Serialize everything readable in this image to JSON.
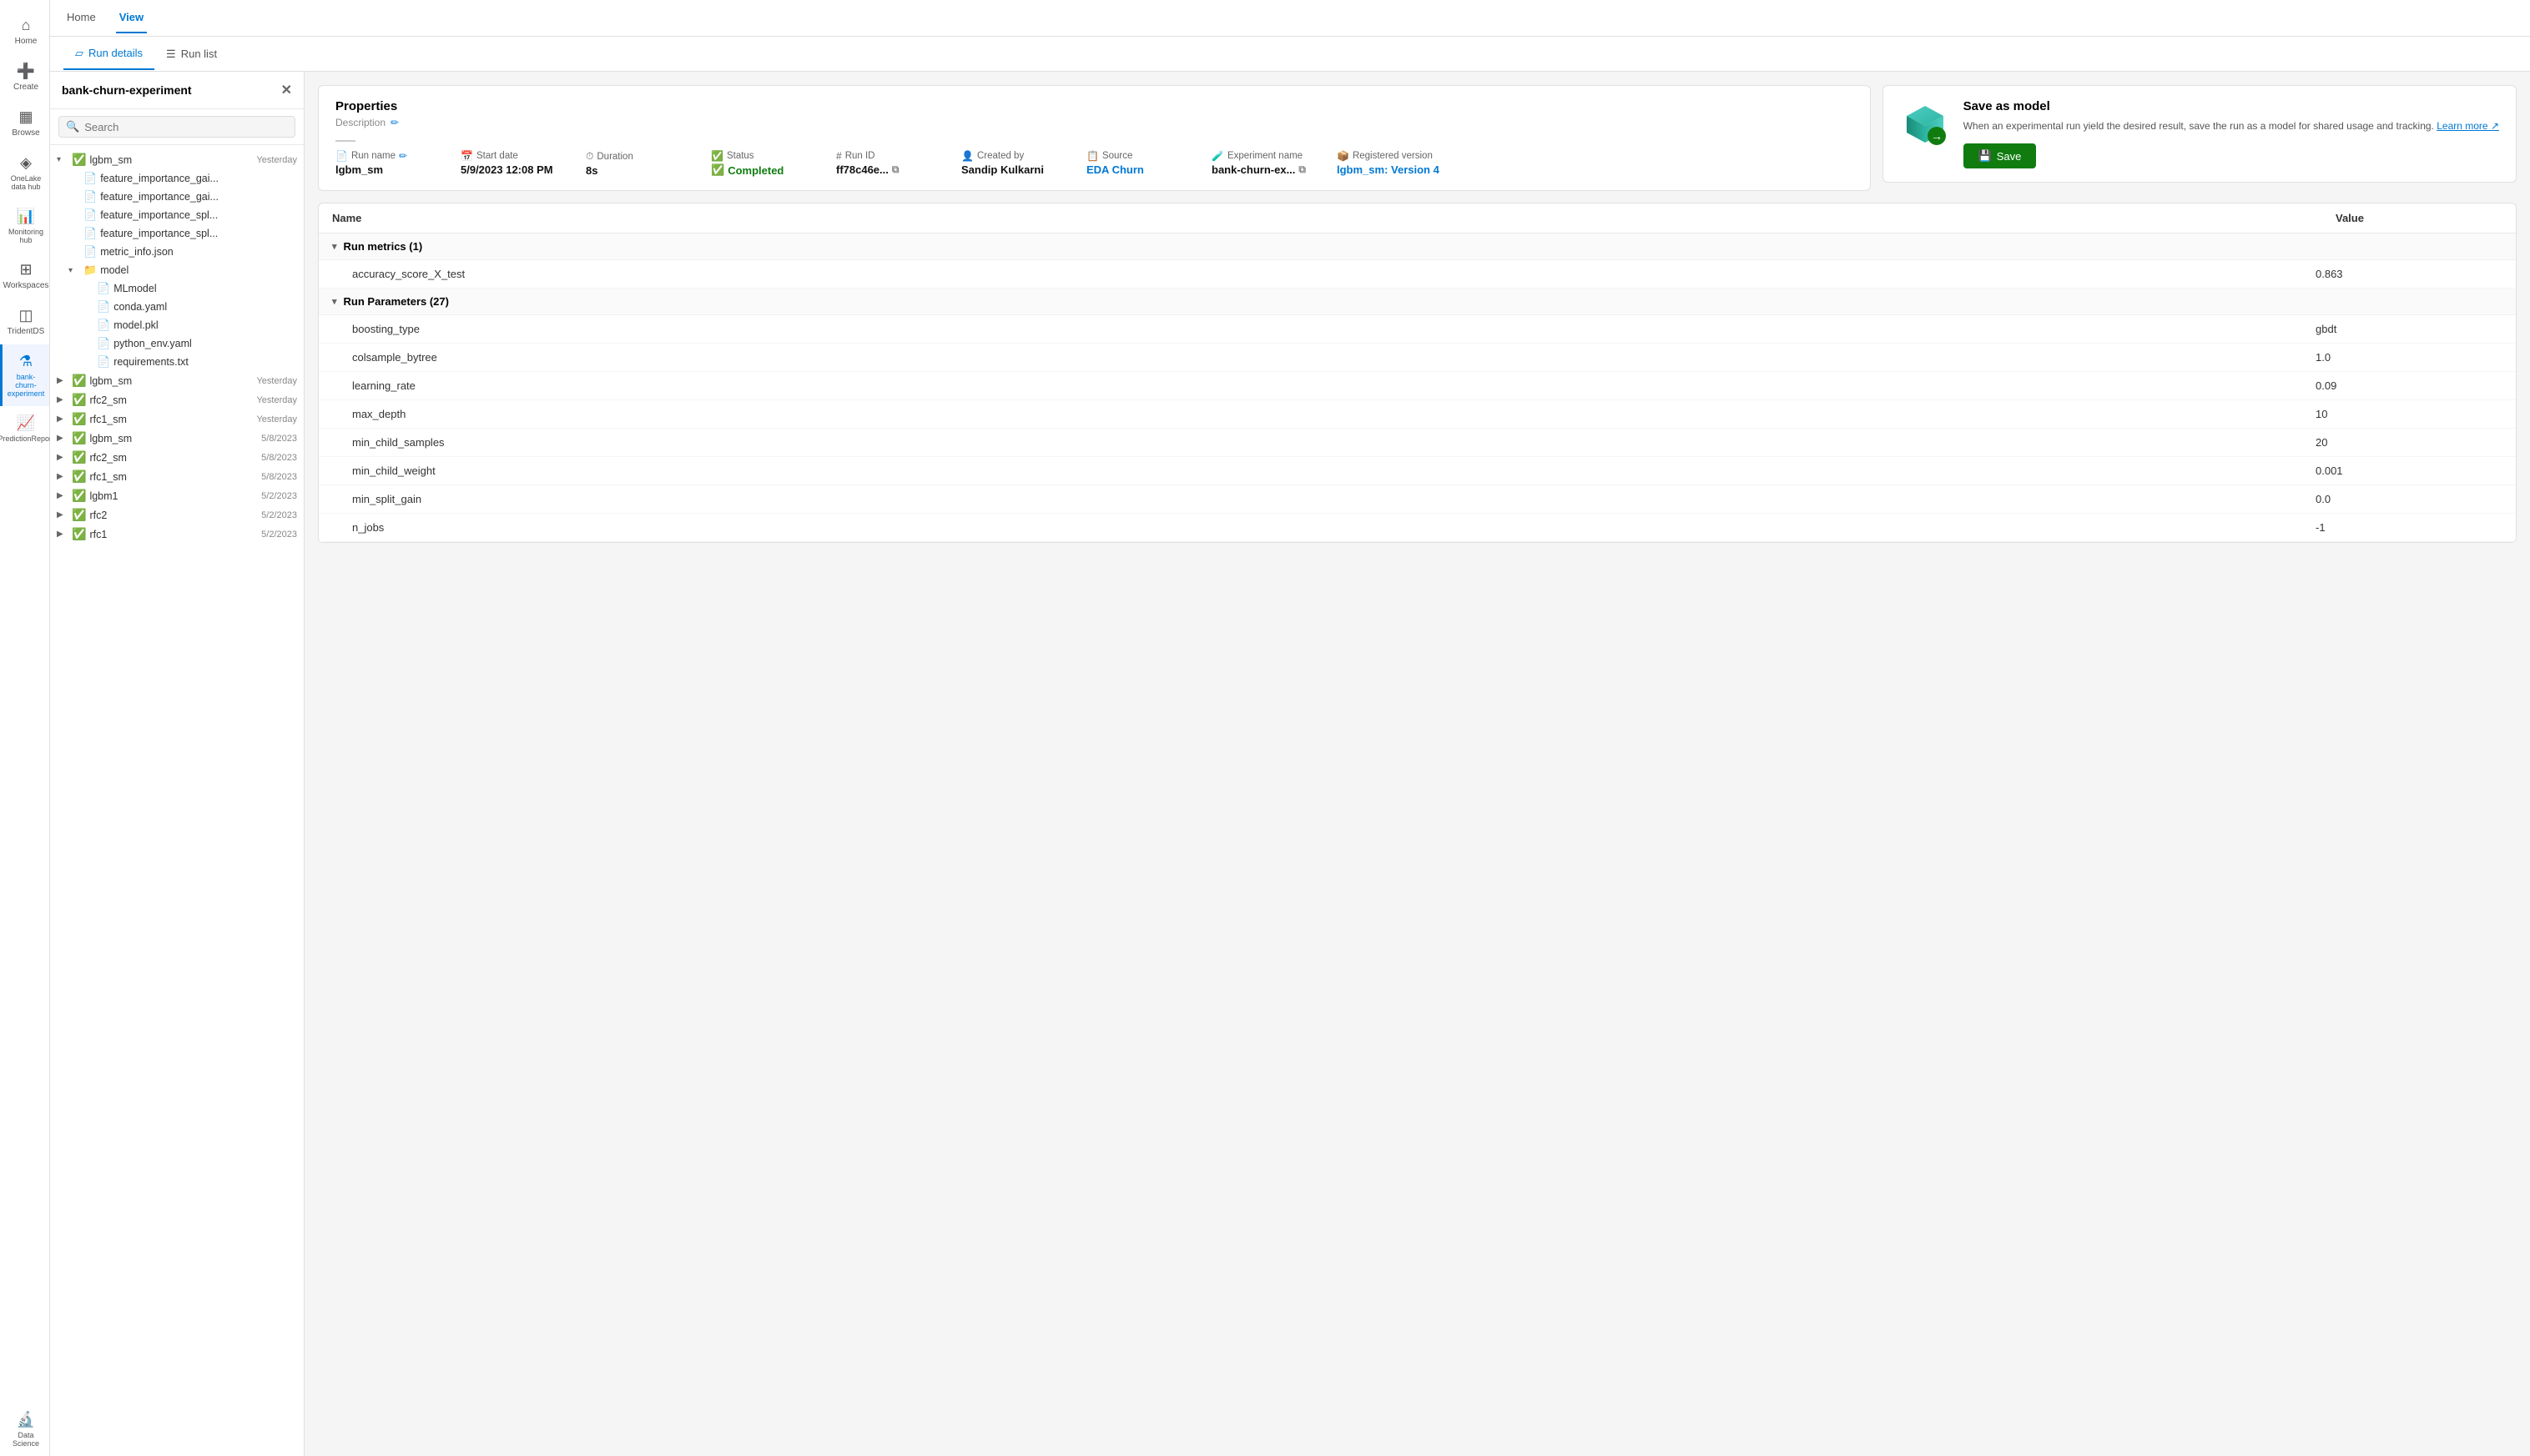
{
  "leftNav": {
    "items": [
      {
        "id": "home",
        "icon": "⌂",
        "label": "Home",
        "active": false
      },
      {
        "id": "create",
        "icon": "+",
        "label": "Create",
        "active": false
      },
      {
        "id": "browse",
        "icon": "▦",
        "label": "Browse",
        "active": false
      },
      {
        "id": "onelake",
        "icon": "◈",
        "label": "OneLake data hub",
        "active": false
      },
      {
        "id": "monitoring",
        "icon": "📊",
        "label": "Monitoring hub",
        "active": false
      },
      {
        "id": "workspaces",
        "icon": "⊞",
        "label": "Workspaces",
        "active": false
      },
      {
        "id": "tridentds",
        "icon": "◫",
        "label": "TridentDS",
        "active": false
      },
      {
        "id": "experiment",
        "icon": "⚗",
        "label": "bank-churn-experiment",
        "active": true
      },
      {
        "id": "prediction",
        "icon": "📈",
        "label": "PredictionReport",
        "active": false
      },
      {
        "id": "datascience",
        "icon": "🔬",
        "label": "Data Science",
        "active": false
      }
    ]
  },
  "topBar": {
    "tabs": [
      {
        "id": "home",
        "label": "Home",
        "active": false
      },
      {
        "id": "view",
        "label": "View",
        "active": true
      }
    ]
  },
  "viewTabs": [
    {
      "id": "run-details",
      "label": "Run details",
      "active": true
    },
    {
      "id": "run-list",
      "label": "Run list",
      "active": false
    }
  ],
  "sidebar": {
    "title": "bank-churn-experiment",
    "searchPlaceholder": "Search",
    "tree": [
      {
        "level": 0,
        "type": "run",
        "expanded": true,
        "status": "success",
        "label": "lgbm_sm",
        "date": "Yesterday"
      },
      {
        "level": 1,
        "type": "file",
        "label": "feature_importance_gai...",
        "date": ""
      },
      {
        "level": 1,
        "type": "file",
        "label": "feature_importance_gai...",
        "date": ""
      },
      {
        "level": 1,
        "type": "file",
        "label": "feature_importance_spl...",
        "date": ""
      },
      {
        "level": 1,
        "type": "file",
        "label": "feature_importance_spl...",
        "date": ""
      },
      {
        "level": 1,
        "type": "file",
        "label": "metric_info.json",
        "date": ""
      },
      {
        "level": 1,
        "type": "folder",
        "expanded": true,
        "label": "model",
        "date": ""
      },
      {
        "level": 2,
        "type": "file",
        "label": "MLmodel",
        "date": ""
      },
      {
        "level": 2,
        "type": "file",
        "label": "conda.yaml",
        "date": ""
      },
      {
        "level": 2,
        "type": "file",
        "label": "model.pkl",
        "date": ""
      },
      {
        "level": 2,
        "type": "file",
        "label": "python_env.yaml",
        "date": ""
      },
      {
        "level": 2,
        "type": "file",
        "label": "requirements.txt",
        "date": ""
      },
      {
        "level": 0,
        "type": "run",
        "expanded": false,
        "status": "success",
        "label": "lgbm_sm",
        "date": "Yesterday"
      },
      {
        "level": 0,
        "type": "run",
        "expanded": false,
        "status": "success",
        "label": "rfc2_sm",
        "date": "Yesterday"
      },
      {
        "level": 0,
        "type": "run",
        "expanded": false,
        "status": "success",
        "label": "rfc1_sm",
        "date": "Yesterday"
      },
      {
        "level": 0,
        "type": "run",
        "expanded": false,
        "status": "success",
        "label": "lgbm_sm",
        "date": "5/8/2023"
      },
      {
        "level": 0,
        "type": "run",
        "expanded": false,
        "status": "success",
        "label": "rfc2_sm",
        "date": "5/8/2023"
      },
      {
        "level": 0,
        "type": "run",
        "expanded": false,
        "status": "success",
        "label": "rfc1_sm",
        "date": "5/8/2023"
      },
      {
        "level": 0,
        "type": "run",
        "expanded": false,
        "status": "success",
        "label": "lgbm1",
        "date": "5/2/2023"
      },
      {
        "level": 0,
        "type": "run",
        "expanded": false,
        "status": "success",
        "label": "rfc2",
        "date": "5/2/2023"
      },
      {
        "level": 0,
        "type": "run",
        "expanded": false,
        "status": "success",
        "label": "rfc1",
        "date": "5/2/2023"
      }
    ]
  },
  "properties": {
    "title": "Properties",
    "descriptionLabel": "Description",
    "divider": "—",
    "fields": [
      {
        "id": "run-name",
        "icon": "📄",
        "label": "Run name",
        "value": "lgbm_sm",
        "hasEdit": true
      },
      {
        "id": "start-date",
        "icon": "📅",
        "label": "Start date",
        "value": "5/9/2023 12:08 PM"
      },
      {
        "id": "duration",
        "icon": "⏱",
        "label": "Duration",
        "value": "8s"
      },
      {
        "id": "status",
        "icon": "✅",
        "label": "Status",
        "value": "Completed",
        "isStatus": true
      },
      {
        "id": "run-id",
        "icon": "#",
        "label": "Run ID",
        "value": "ff78c46e...",
        "hasCopy": true
      },
      {
        "id": "created-by",
        "icon": "👤",
        "label": "Created by",
        "value": "Sandip Kulkarni"
      },
      {
        "id": "source",
        "icon": "📋",
        "label": "Source",
        "value": "EDA Churn",
        "isLink": true
      },
      {
        "id": "experiment-name",
        "icon": "🧪",
        "label": "Experiment name",
        "value": "bank-churn-ex...",
        "hasCopy": true
      },
      {
        "id": "registered-version",
        "icon": "📦",
        "label": "Registered version",
        "value": "lgbm_sm: Version 4",
        "isLink": true
      }
    ]
  },
  "saveAsModel": {
    "title": "Save as model",
    "description": "When an experimental run yield the desired result, save the run as a model for shared usage and tracking.",
    "learnMoreLabel": "Learn more",
    "saveLabel": "Save"
  },
  "metricsTable": {
    "colNameHeader": "Name",
    "colValueHeader": "Value",
    "sections": [
      {
        "title": "Run metrics (1)",
        "expanded": true,
        "rows": [
          {
            "name": "accuracy_score_X_test",
            "value": "0.863"
          }
        ]
      },
      {
        "title": "Run Parameters (27)",
        "expanded": true,
        "rows": [
          {
            "name": "boosting_type",
            "value": "gbdt"
          },
          {
            "name": "colsample_bytree",
            "value": "1.0"
          },
          {
            "name": "learning_rate",
            "value": "0.09"
          },
          {
            "name": "max_depth",
            "value": "10"
          },
          {
            "name": "min_child_samples",
            "value": "20"
          },
          {
            "name": "min_child_weight",
            "value": "0.001"
          },
          {
            "name": "min_split_gain",
            "value": "0.0"
          },
          {
            "name": "n_jobs",
            "value": "-1"
          }
        ]
      }
    ]
  }
}
